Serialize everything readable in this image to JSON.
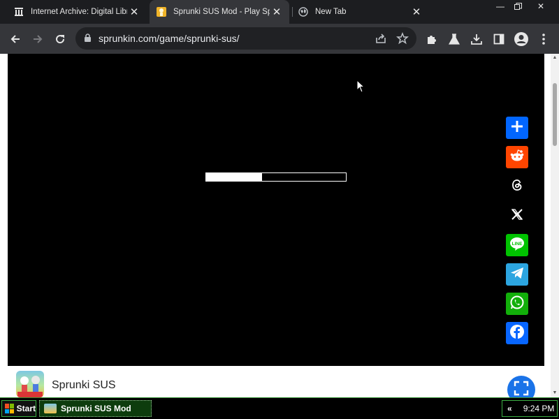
{
  "browser": {
    "tabs": [
      {
        "title": "Internet Archive: Digital Libr",
        "icon": "internet-archive-icon",
        "active": false
      },
      {
        "title": "Sprunki SUS Mod - Play Spru",
        "icon": "sprunki-favicon",
        "active": true
      },
      {
        "title": "New Tab",
        "icon": "globe-icon",
        "active": false
      }
    ],
    "address_bar": {
      "url": "sprunkin.com/game/sprunki-sus/"
    },
    "toolbar_icons": [
      "back-icon",
      "forward-icon",
      "reload-icon",
      "lock-icon",
      "share-icon",
      "star-icon",
      "extensions-icon",
      "labs-icon",
      "download-icon",
      "side-panel-icon",
      "profile-icon",
      "menu-icon"
    ]
  },
  "game": {
    "loading_progress": 0.4
  },
  "share_buttons": [
    {
      "name": "addtoany",
      "icon": "plus-icon",
      "color": "#0166ff"
    },
    {
      "name": "reddit",
      "icon": "reddit-icon",
      "color": "#ff4500"
    },
    {
      "name": "threads",
      "icon": "threads-icon",
      "color": "#000000"
    },
    {
      "name": "x",
      "icon": "x-icon",
      "color": "#000000"
    },
    {
      "name": "line",
      "icon": "line-icon",
      "color": "#00c300"
    },
    {
      "name": "telegram",
      "icon": "telegram-icon",
      "color": "#2ca5e0"
    },
    {
      "name": "whatsapp",
      "icon": "whatsapp-icon",
      "color": "#12af0a"
    },
    {
      "name": "facebook",
      "icon": "facebook-icon",
      "color": "#0866ff"
    }
  ],
  "page": {
    "game_title": "Sprunki SUS"
  },
  "taskbar": {
    "start_label": "Start",
    "task_label": "Sprunki SUS Mod",
    "tray_chevron": "«",
    "clock": "9:24 PM"
  },
  "colors": {
    "accent_blue": "#1a73e8",
    "taskbar_green": "#3cb043"
  }
}
